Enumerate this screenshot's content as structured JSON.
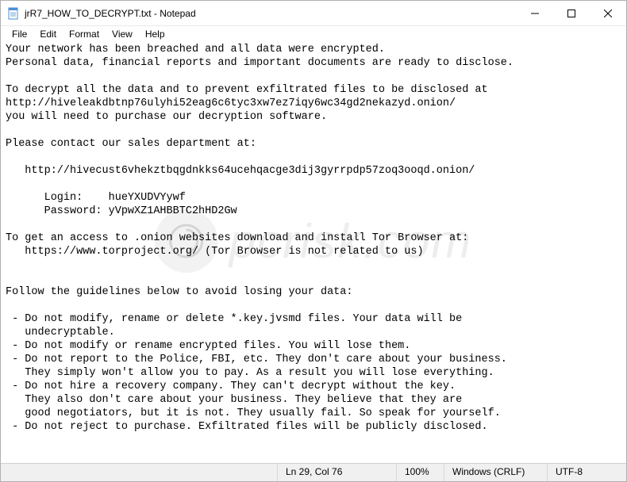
{
  "window": {
    "title": "jrR7_HOW_TO_DECRYPT.txt - Notepad"
  },
  "menu": {
    "file": "File",
    "edit": "Edit",
    "format": "Format",
    "view": "View",
    "help": "Help"
  },
  "body_text": "Your network has been breached and all data were encrypted.\nPersonal data, financial reports and important documents are ready to disclose.\n\nTo decrypt all the data and to prevent exfiltrated files to be disclosed at\nhttp://hiveleakdbtnp76ulyhi52eag6c6tyc3xw7ez7iqy6wc34gd2nekazyd.onion/\nyou will need to purchase our decryption software.\n\nPlease contact our sales department at:\n\n   http://hivecust6vhekztbqgdnkks64ucehqacge3dij3gyrrpdp57zoq3ooqd.onion/\n\n      Login:    hueYXUDVYywf\n      Password: yVpwXZ1AHBBTC2hHD2Gw\n\nTo get an access to .onion websites download and install Tor Browser at:\n   https://www.torproject.org/ (Tor Browser is not related to us)\n\n\nFollow the guidelines below to avoid losing your data:\n\n - Do not modify, rename or delete *.key.jvsmd files. Your data will be\n   undecryptable.\n - Do not modify or rename encrypted files. You will lose them.\n - Do not report to the Police, FBI, etc. They don't care about your business.\n   They simply won't allow you to pay. As a result you will lose everything.\n - Do not hire a recovery company. They can't decrypt without the key.\n   They also don't care about your business. They believe that they are\n   good negotiators, but it is not. They usually fail. So speak for yourself.\n - Do not reject to purchase. Exfiltrated files will be publicly disclosed.",
  "status": {
    "position": "Ln 29, Col 76",
    "zoom": "100%",
    "line_ending": "Windows (CRLF)",
    "encoding": "UTF-8"
  },
  "watermark": "pcrisk.com"
}
